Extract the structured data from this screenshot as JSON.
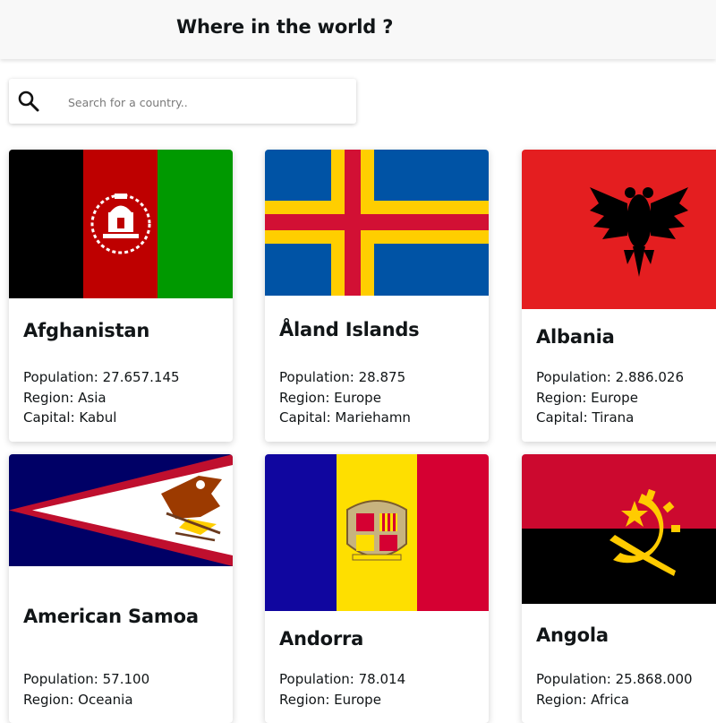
{
  "header": {
    "title": "Where in the world ?"
  },
  "search": {
    "placeholder": "Search for a country..",
    "value": ""
  },
  "labels": {
    "population": "Population: ",
    "region": "Region: ",
    "capital": "Capital: "
  },
  "countries": [
    {
      "name": "Afghanistan",
      "population": "27.657.145",
      "region": "Asia",
      "capital": "Kabul"
    },
    {
      "name": "Åland Islands",
      "population": "28.875",
      "region": "Europe",
      "capital": "Mariehamn"
    },
    {
      "name": "Albania",
      "population": "2.886.026",
      "region": "Europe",
      "capital": "Tirana"
    },
    {
      "name": "American Samoa",
      "population": "57.100",
      "region": "Oceania"
    },
    {
      "name": "Andorra",
      "population": "78.014",
      "region": "Europe"
    },
    {
      "name": "Angola",
      "population": "25.868.000",
      "region": "Africa"
    }
  ],
  "icons": {
    "search": "search-icon"
  },
  "colors": {
    "header_bg": "#f8f8f8",
    "text": "#111517",
    "page_bg": "#ffffff"
  }
}
